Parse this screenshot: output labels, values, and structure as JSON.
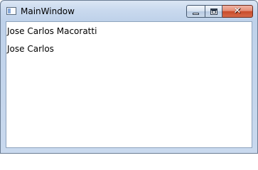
{
  "window": {
    "title": "MainWindow",
    "icon": "app-window-icon",
    "controls": {
      "minimize_icon": "minimize-icon",
      "maximize_icon": "maximize-icon",
      "close_icon": "close-icon",
      "close_glyph": "✕"
    }
  },
  "content": {
    "label1": "Jose Carlos Macoratti",
    "label2": "Jose Carlos"
  },
  "colors": {
    "frame": "#c9d9ee",
    "close_button": "#c94b2a",
    "client_background": "#ffffff"
  }
}
